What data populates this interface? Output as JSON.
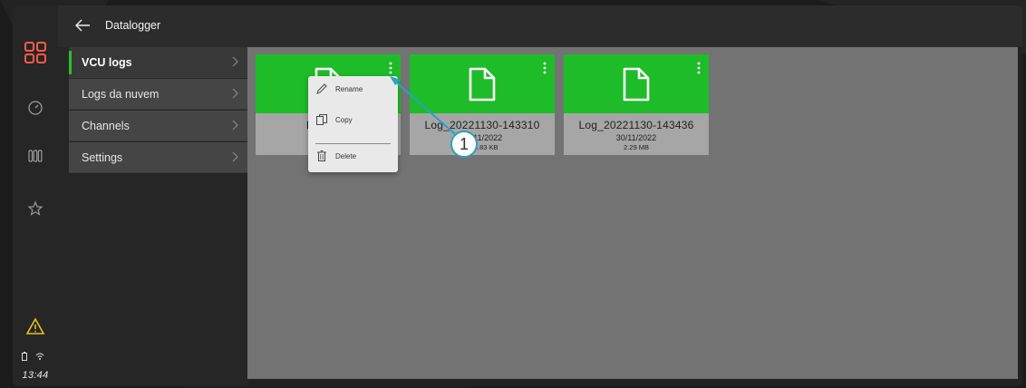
{
  "header": {
    "title": "Datalogger"
  },
  "menu": {
    "items": [
      {
        "label": "VCU logs"
      },
      {
        "label": "Logs da nuvem"
      },
      {
        "label": "Channels"
      },
      {
        "label": "Settings"
      }
    ]
  },
  "files": [
    {
      "name": "Log_202",
      "date": "1",
      "size": ""
    },
    {
      "name": "Log_20221130-143310",
      "date": "30/11/2022",
      "size": "375.83 KB"
    },
    {
      "name": "Log_20221130-143436",
      "date": "30/11/2022",
      "size": "2.29 MB"
    }
  ],
  "context_menu": {
    "rename": "Rename",
    "copy": "Copy",
    "delete": "Delete"
  },
  "callout": {
    "number": "1"
  },
  "status": {
    "time": "13:44"
  },
  "colors": {
    "accent": "#1ebc28",
    "warning": "#e8c020",
    "callout": "#2e9dc9"
  },
  "icons": [
    "home-grid-icon",
    "speedometer-icon",
    "columns-icon",
    "star-icon",
    "warning-icon",
    "battery-icon",
    "wifi-icon",
    "back-arrow-icon",
    "chevron-right-icon",
    "document-icon",
    "kebab-icon",
    "pencil-icon",
    "copy-icon",
    "trash-icon"
  ]
}
